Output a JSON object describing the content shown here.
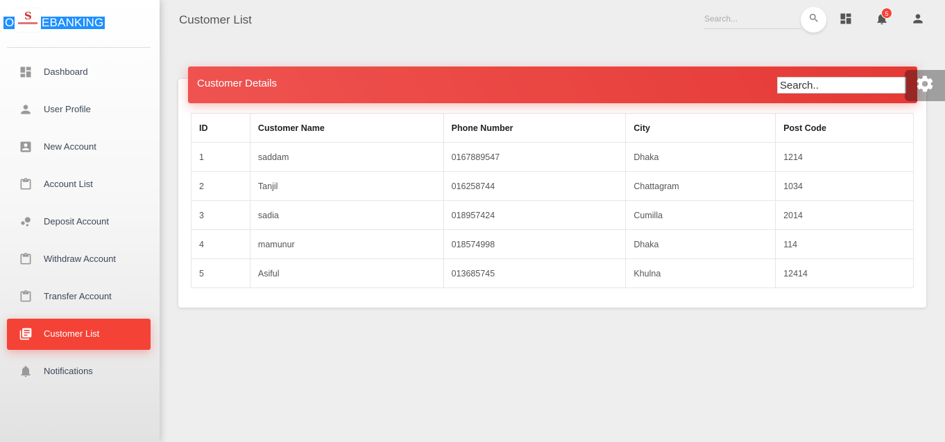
{
  "brand": {
    "text": "ONLINEBANKING",
    "logo_text": "S"
  },
  "sidebar": {
    "items": [
      {
        "label": "Dashboard",
        "icon": "dashboard-icon"
      },
      {
        "label": "User Profile",
        "icon": "person-icon"
      },
      {
        "label": "New Account",
        "icon": "account-box-icon"
      },
      {
        "label": "Account List",
        "icon": "clipboard-icon"
      },
      {
        "label": "Deposit Account",
        "icon": "bubble-chart-icon"
      },
      {
        "label": "Withdraw Account",
        "icon": "clipboard-icon"
      },
      {
        "label": "Transfer Account",
        "icon": "clipboard-icon"
      },
      {
        "label": "Customer List",
        "icon": "library-books-icon",
        "active": true
      },
      {
        "label": "Notifications",
        "icon": "bell-icon"
      }
    ]
  },
  "header": {
    "title": "Customer List",
    "search_placeholder": "Search...",
    "notification_count": "5"
  },
  "card": {
    "title": "Customer Details",
    "search_placeholder": "Search.."
  },
  "table": {
    "columns": [
      "ID",
      "Customer Name",
      "Phone Number",
      "City",
      "Post Code"
    ],
    "rows": [
      [
        "1",
        "saddam",
        "0167889547",
        "Dhaka",
        "1214"
      ],
      [
        "2",
        "Tanjil",
        "016258744",
        "Chattagram",
        "1034"
      ],
      [
        "3",
        "sadia",
        "018957424",
        "Cumilla",
        "2014"
      ],
      [
        "4",
        "mamunur",
        "018574998",
        "Dhaka",
        "114"
      ],
      [
        "5",
        "Asiful",
        "013685745",
        "Khulna",
        "12414"
      ]
    ]
  },
  "colors": {
    "accent": "#f44336",
    "header_gradient_start": "#ef5350",
    "header_gradient_end": "#e53935",
    "brand_highlight": "#1e90ff"
  }
}
